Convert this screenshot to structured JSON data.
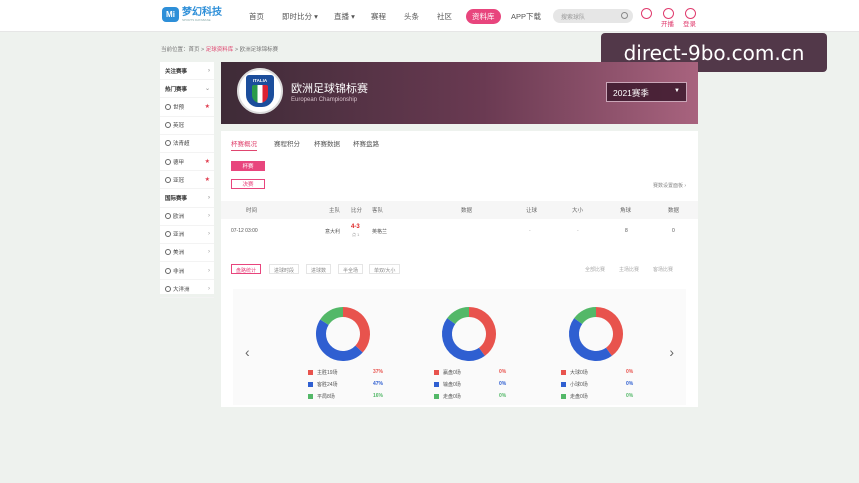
{
  "nav": {
    "logo_text": "梦幻科技",
    "logo_sub": "SPORTS DATABASE",
    "items": [
      {
        "label": "首页"
      },
      {
        "label": "即时比分 ▾"
      },
      {
        "label": "直播 ▾"
      },
      {
        "label": "赛程"
      },
      {
        "label": "头条"
      },
      {
        "label": "社区"
      },
      {
        "label": "资料库"
      },
      {
        "label": "APP下载"
      }
    ],
    "search_placeholder": "搜索球队",
    "open_label": "开播",
    "login_label": "登录",
    "accent": "#e8457d"
  },
  "watermark": "direct-9bo.com.cn",
  "breadcrumb": {
    "prefix": "当前位置：首页 > ",
    "highlight": "足球资料库",
    "suffix": " > 欧洲足球锦标赛"
  },
  "sidebar": {
    "items": [
      {
        "label": "关注赛事",
        "kind": "group",
        "mark": "›"
      },
      {
        "label": "热门赛事",
        "kind": "group",
        "mark": "⌄"
      },
      {
        "label": "世预",
        "kind": "item",
        "mark": "★"
      },
      {
        "label": "英冠",
        "kind": "item",
        "mark": ""
      },
      {
        "label": "法青超",
        "kind": "item",
        "mark": ""
      },
      {
        "label": "德甲",
        "kind": "item",
        "mark": "★"
      },
      {
        "label": "亚冠",
        "kind": "item",
        "mark": "★"
      },
      {
        "label": "国际赛事",
        "kind": "group",
        "mark": "›"
      },
      {
        "label": "欧洲",
        "kind": "item",
        "mark": "›"
      },
      {
        "label": "亚洲",
        "kind": "item",
        "mark": "›"
      },
      {
        "label": "美洲",
        "kind": "item",
        "mark": "›"
      },
      {
        "label": "非洲",
        "kind": "item",
        "mark": "›"
      },
      {
        "label": "大洋洲",
        "kind": "item",
        "mark": "›"
      }
    ]
  },
  "banner": {
    "title": "欧洲足球锦标赛",
    "subtitle": "European Championship",
    "crest_text": "ITALIA",
    "season": "2021赛季"
  },
  "tabs": [
    {
      "label": "杯赛概况"
    },
    {
      "label": "赛程积分"
    },
    {
      "label": "杯赛数据"
    },
    {
      "label": "杯赛盘路"
    }
  ],
  "stage_pills": [
    "杯赛",
    "决赛"
  ],
  "settings_link": "赛数设置面板 ›",
  "table": {
    "headers": [
      "时间",
      "主队",
      "比分",
      "客队",
      "数据",
      "让球",
      "大小",
      "角球",
      "数据"
    ],
    "row": {
      "time": "07-12 03:00",
      "home": "意大利",
      "score": "4-3",
      "sub_score": "点 1",
      "away": "英格兰",
      "data": "",
      "handicap": "-",
      "total": "-",
      "corner": "8",
      "stat": "0"
    }
  },
  "stat_buttons": [
    "盘路统计",
    "进球时段",
    "进球数",
    "半全场",
    "单双/大小"
  ],
  "right_links": [
    "全部比赛",
    "主场比赛",
    "客场比赛"
  ],
  "donuts": [
    {
      "legend": [
        {
          "label": "主胜19场",
          "pct": "37%",
          "color": "#e8534d"
        },
        {
          "label": "客胜24场",
          "pct": "47%",
          "color": "#2f5fd1"
        },
        {
          "label": "平局8场",
          "pct": "16%",
          "color": "#53b868"
        }
      ],
      "values": [
        37,
        47,
        16
      ]
    },
    {
      "legend": [
        {
          "label": "赢盘0场",
          "pct": "0%",
          "color": "#e8534d"
        },
        {
          "label": "输盘0场",
          "pct": "0%",
          "color": "#2f5fd1"
        },
        {
          "label": "走盘0场",
          "pct": "0%",
          "color": "#53b868"
        }
      ],
      "values": [
        40,
        45,
        15
      ]
    },
    {
      "legend": [
        {
          "label": "大球0场",
          "pct": "0%",
          "color": "#e8534d"
        },
        {
          "label": "小球0场",
          "pct": "0%",
          "color": "#2f5fd1"
        },
        {
          "label": "走盘0场",
          "pct": "0%",
          "color": "#53b868"
        }
      ],
      "values": [
        40,
        45,
        15
      ]
    }
  ]
}
